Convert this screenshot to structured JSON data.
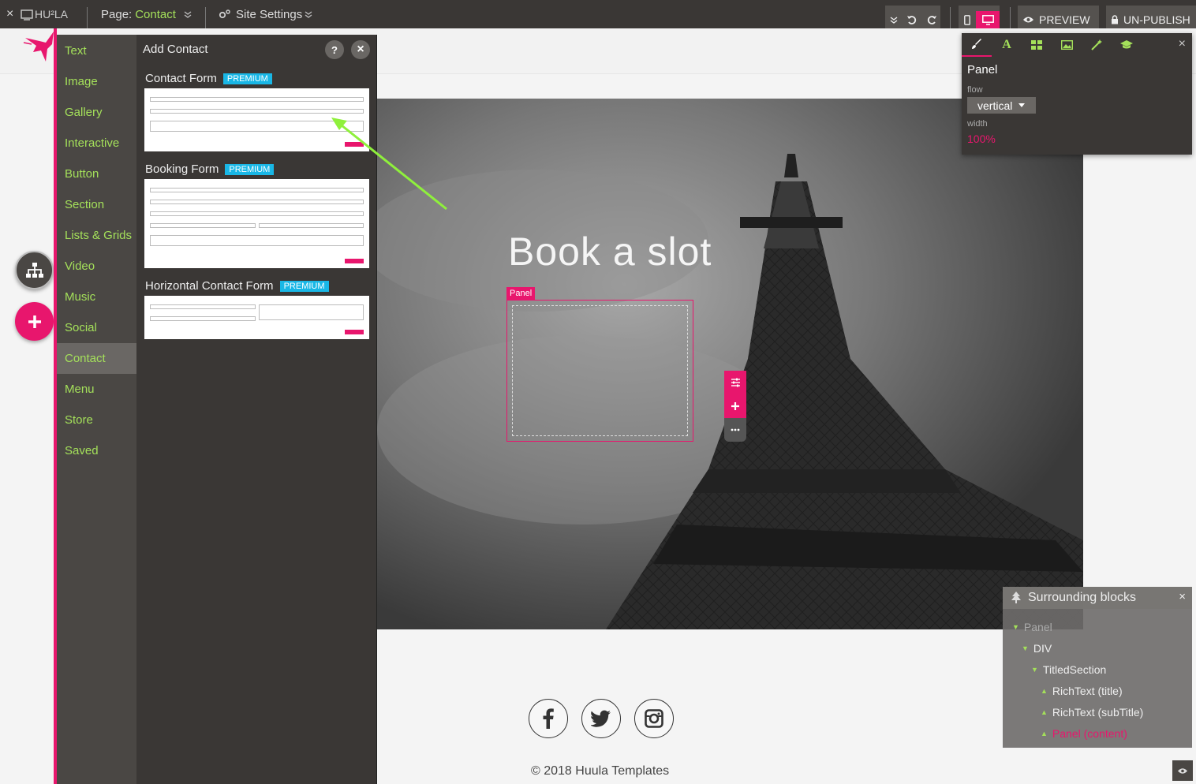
{
  "topbar": {
    "close": "×",
    "logo": "HU²LA",
    "page_label": "Page:",
    "page_name": "Contact",
    "site_settings": "Site Settings",
    "preview": "PREVIEW",
    "unpublish": "UN-PUBLISH"
  },
  "side_menu": {
    "items": [
      {
        "label": "Text"
      },
      {
        "label": "Image"
      },
      {
        "label": "Gallery"
      },
      {
        "label": "Interactive"
      },
      {
        "label": "Button"
      },
      {
        "label": "Section"
      },
      {
        "label": "Lists & Grids"
      },
      {
        "label": "Video"
      },
      {
        "label": "Music"
      },
      {
        "label": "Social"
      },
      {
        "label": "Contact"
      },
      {
        "label": "Menu"
      },
      {
        "label": "Store"
      },
      {
        "label": "Saved"
      }
    ],
    "active": "Contact"
  },
  "add_panel": {
    "title": "Add Contact",
    "help": "?",
    "close": "×",
    "templates": [
      {
        "name": "Contact Form",
        "badge": "PREMIUM"
      },
      {
        "name": "Booking Form",
        "badge": "PREMIUM"
      },
      {
        "name": "Horizontal Contact Form",
        "badge": "PREMIUM"
      }
    ]
  },
  "canvas": {
    "hero_title": "Book a slot",
    "panel_tag": "Panel",
    "copyright": "© 2018 Huula Templates",
    "social_icons": [
      "facebook-icon",
      "twitter-icon",
      "instagram-icon"
    ]
  },
  "properties": {
    "title": "Panel",
    "flow_label": "flow",
    "flow_value": "vertical",
    "width_label": "width",
    "width_value": "100%",
    "close": "×"
  },
  "surrounding": {
    "title": "Surrounding blocks",
    "close": "×",
    "items": [
      {
        "label": "Panel"
      },
      {
        "label": "DIV"
      },
      {
        "label": "TitledSection"
      },
      {
        "label": "RichText (title)"
      },
      {
        "label": "RichText (subTitle)"
      },
      {
        "label": "Panel (content)"
      }
    ]
  },
  "colors": {
    "accent": "#e8166d",
    "green": "#a4e05a",
    "badge": "#19b7e6",
    "dark": "#3a3735"
  }
}
